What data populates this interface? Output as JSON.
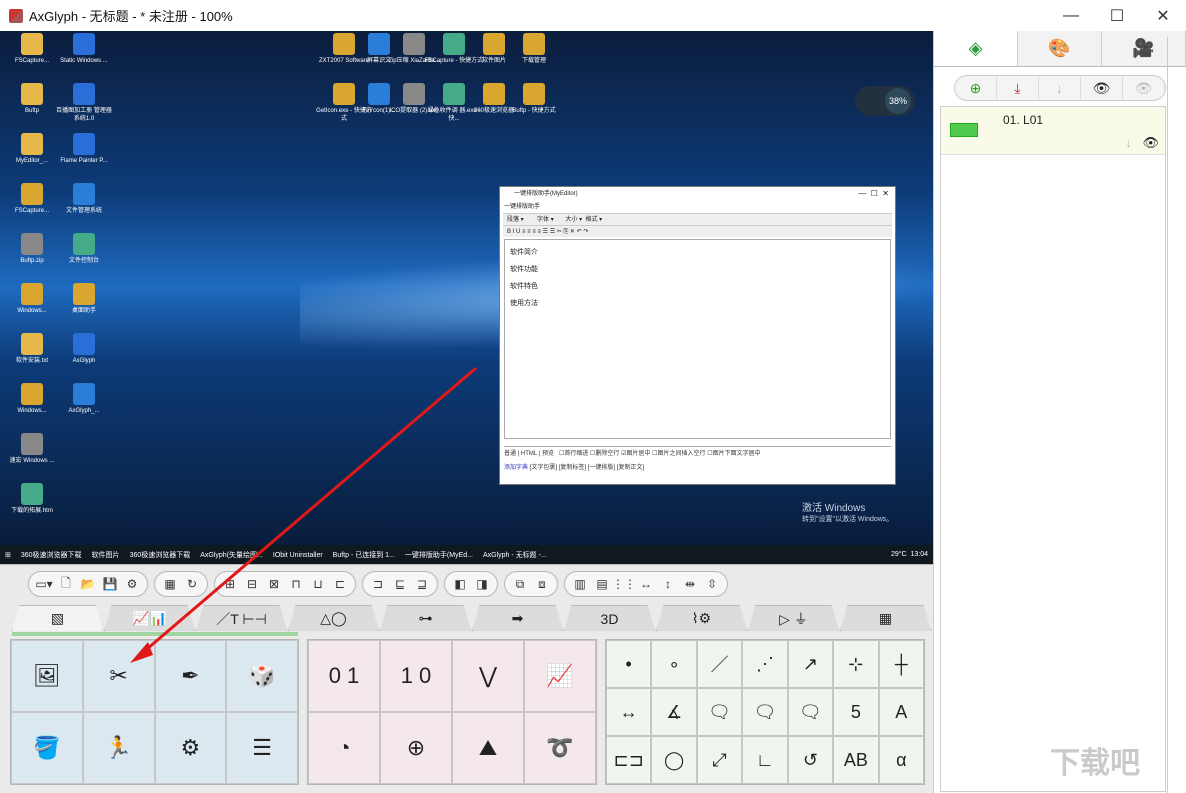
{
  "window": {
    "title": "AxGlyph - 无标题 - * 未注册 - 100%",
    "minimize": "—",
    "maximize": "☐",
    "close": "✕"
  },
  "desktop": {
    "icons": [
      {
        "label": "FSCapture..."
      },
      {
        "label": "Static Windows ..."
      },
      {
        "label": "ZXT2007 Software"
      },
      {
        "label": "屏幕识文"
      },
      {
        "label": "Zip压缩 XiaZaiBa..."
      },
      {
        "label": "FSCapture - 快捷方式"
      },
      {
        "label": "软件图片"
      },
      {
        "label": "下载管理"
      },
      {
        "label": "Buftp"
      },
      {
        "label": "百播图加工册 管理器系统1.0"
      },
      {
        "label": "GetIcon.exe - 快捷方式"
      },
      {
        "label": "ToYcon(1)..."
      },
      {
        "label": "ICO提取器 (2).exe"
      },
      {
        "label": "绿色收件调 器.exe - 快..."
      },
      {
        "label": "360极速浏览器"
      },
      {
        "label": "Buftp - 快捷方式"
      },
      {
        "label": "MyEditor_..."
      },
      {
        "label": "Flame Painter P..."
      },
      {
        "label": "FSCapture..."
      },
      {
        "label": "文件管理系统"
      },
      {
        "label": "Buftp.zip"
      },
      {
        "label": "文件控制台"
      },
      {
        "label": "Windows..."
      },
      {
        "label": "桌面助手"
      },
      {
        "label": "软件安装.txt"
      },
      {
        "label": "AxGlyph"
      },
      {
        "label": "Windows..."
      },
      {
        "label": "AxGlyph_..."
      },
      {
        "label": "速宏 Windows ..."
      },
      {
        "label": "下载的拓展.htm"
      }
    ],
    "gadget": {
      "percent": "38%"
    },
    "activate": {
      "line1": "激活 Windows",
      "line2": "转到\"设置\"以激活 Windows。"
    },
    "taskbar": [
      "360极速浏览器下载",
      "软件图片",
      "360极速浏览器下载",
      "AxGlyph(矢量绘图...",
      "IObit Uninstaller",
      "Buftp - 已连接到 1...",
      "一键排版助手(MyEd...",
      "AxGlyph - 无标题 -..."
    ],
    "clock": {
      "temp": "29°C",
      "time": "13:04"
    }
  },
  "editor": {
    "title": "一键排版助手(MyEditor)",
    "menu": "一键排版助手",
    "fields": [
      "段落",
      "字体",
      "大小",
      "格式"
    ],
    "lines": [
      "软件简介",
      "软件功能",
      "软件特色",
      "使用方法"
    ],
    "bottom_tabs": [
      "普通",
      "HTML",
      "预览"
    ],
    "bottom_opts": [
      "首行缩进",
      "删除空行",
      "图片居中",
      "图片之间插入空行",
      "图片下面文字居中"
    ],
    "bottom_buttons": [
      "添加字典",
      "文字包裹",
      "复制标签",
      "一键排版",
      "复制正文"
    ]
  },
  "sidepanel": {
    "tabs": [
      "layers-icon",
      "palette-icon",
      "camera-icon"
    ],
    "toolbar": [
      "add-layer-icon",
      "merge-down-icon",
      "move-down-icon",
      "show-icon",
      "hide-icon"
    ],
    "layers": [
      {
        "name": "01. L01"
      }
    ]
  },
  "toolbar": {
    "groups": [
      [
        "▭▾",
        "🗋",
        "📂",
        "💾",
        "⚙"
      ],
      [
        "▦",
        "↻"
      ],
      [
        "⊞",
        "⊟",
        "⊠",
        "⊓",
        "⊔",
        "⊏"
      ],
      [
        "⊐",
        "⊑",
        "⊒"
      ],
      [
        "◧",
        "◨"
      ],
      [
        "⧉",
        "⧈"
      ],
      [
        "▥",
        "▤",
        "⋮⋮",
        "↔",
        "↕",
        "⇹",
        "⇳"
      ]
    ]
  },
  "categories": [
    {
      "label": "▧",
      "active": true
    },
    {
      "label": "📈📊"
    },
    {
      "label": "／T ⊢⊣"
    },
    {
      "label": "△◯"
    },
    {
      "label": "⊶"
    },
    {
      "label": "➡"
    },
    {
      "label": "3D"
    },
    {
      "label": "⌇⚙"
    },
    {
      "label": "▷ ⏚"
    },
    {
      "label": "▦"
    }
  ],
  "panel1": [
    "🖼",
    "✂",
    "✒",
    "🎲",
    "🪣",
    "🏃",
    "⚙",
    "☰"
  ],
  "panel2": [
    "0 1",
    "1 0",
    "⋁",
    "📈",
    "◔",
    "⊕",
    "⛰",
    "➰"
  ],
  "panel3": [
    "•",
    "∘",
    "／",
    "⋰",
    "↗",
    "⊹",
    "┼",
    "↔",
    "∡",
    "🗨",
    "🗨",
    "🗨",
    "5",
    "A",
    "⊏⊐",
    "◯",
    "⤢",
    "∟",
    "↺",
    "AB",
    "α"
  ],
  "watermark": "下载吧"
}
